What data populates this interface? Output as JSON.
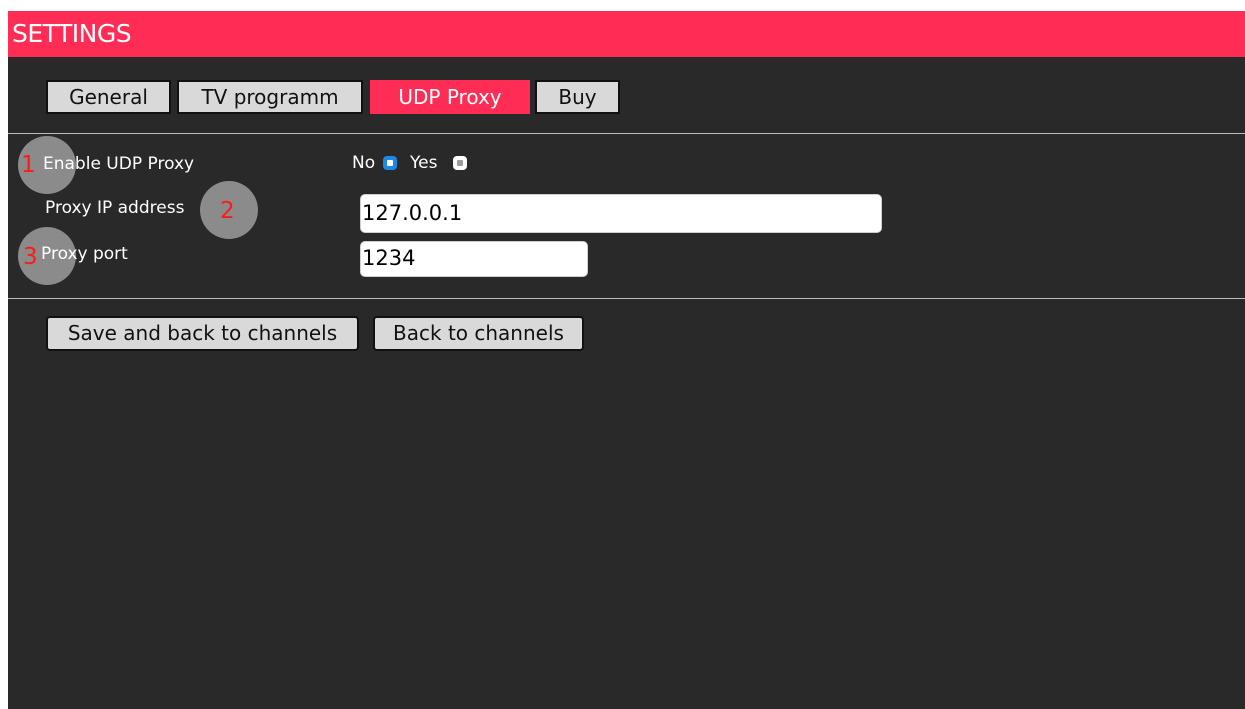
{
  "header": {
    "title": "SETTINGS"
  },
  "tabs": [
    {
      "label": "General",
      "active": false
    },
    {
      "label": "TV programm",
      "active": false
    },
    {
      "label": "UDP Proxy",
      "active": true
    },
    {
      "label": "Buy",
      "active": false
    }
  ],
  "form": {
    "enable_udp_proxy": {
      "label": "Enable UDP Proxy",
      "options": [
        {
          "label": "No",
          "selected": true
        },
        {
          "label": "Yes",
          "selected": false
        }
      ]
    },
    "proxy_ip": {
      "label": "Proxy IP address",
      "value": "127.0.0.1"
    },
    "proxy_port": {
      "label": "Proxy port",
      "value": "1234"
    }
  },
  "markers": [
    "1",
    "2",
    "3"
  ],
  "buttons": {
    "save_back": "Save and back to channels",
    "back": "Back to channels"
  },
  "colors": {
    "accent": "#ff2d55",
    "background": "#292929",
    "radio_selected": "#1e88e5",
    "marker_number": "#ff1a1a"
  }
}
